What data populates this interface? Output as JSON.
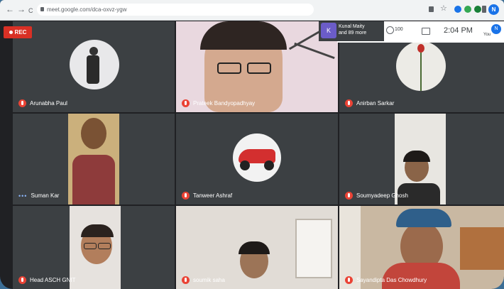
{
  "browser": {
    "nav_back": "←",
    "nav_forward": "→",
    "nav_reload": "C",
    "url": "meet.google.com/dca-oxvz-ygw"
  },
  "meeting": {
    "rec_label": "REC",
    "presenter_initial": "K",
    "presenter_name": "Kunal Maity",
    "presenter_more": "and 89 more",
    "participant_count": "100",
    "time": "2:04 PM",
    "self_initial": "N",
    "self_label": "You"
  },
  "participants": [
    {
      "name": "Arunabha Paul",
      "muted": true
    },
    {
      "name": "Prateek Bandyopadhyay",
      "muted": true
    },
    {
      "name": "Anirban Sarkar",
      "muted": true
    },
    {
      "name": "Suman Kar",
      "muted": false
    },
    {
      "name": "Tanweer Ashraf",
      "muted": true
    },
    {
      "name": "Soumyadeep Ghosh",
      "muted": true
    },
    {
      "name": "Head ASCH GNIT",
      "muted": true
    },
    {
      "name": "soumik saha",
      "muted": true
    },
    {
      "name": "Sayandipta Das Chowdhury",
      "muted": true
    }
  ],
  "colors": {
    "meet_background": "#202124",
    "tile_background": "#3c4043",
    "rec_red": "#d93025",
    "mute_red": "#ea4335",
    "accent_blue": "#1a73e8"
  }
}
